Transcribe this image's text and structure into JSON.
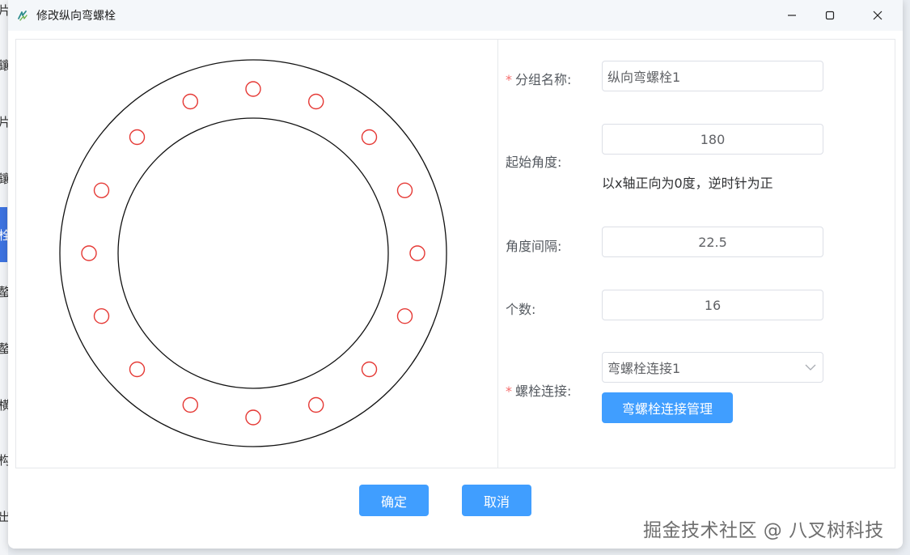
{
  "window": {
    "title": "修改纵向弯螺栓",
    "minimize_icon": "minimize-icon",
    "maximize_icon": "maximize-icon",
    "close_icon": "close-icon"
  },
  "background_app": {
    "side_chars": [
      "片",
      "鑲",
      "片",
      "鑲",
      "栓",
      "螯",
      "螯",
      "横",
      "构",
      "出"
    ]
  },
  "drawing": {
    "bolt_count": 16,
    "bolt_color": "#e53935",
    "ring_color": "#111111"
  },
  "form": {
    "group_name": {
      "label": "分组名称:",
      "required": "*",
      "value": "纵向弯螺栓1"
    },
    "start_angle": {
      "label": "起始角度:",
      "value": "180",
      "hint": "以x轴正向为0度，逆时针为正"
    },
    "angle_interval": {
      "label": "角度间隔:",
      "value": "22.5"
    },
    "count": {
      "label": "个数:",
      "value": "16"
    },
    "bolt_connection": {
      "label": "螺栓连接:",
      "required": "*",
      "value": "弯螺栓连接1",
      "manage_button": "弯螺栓连接管理"
    }
  },
  "footer": {
    "confirm": "确定",
    "cancel": "取消"
  },
  "watermark": "掘金技术社区 @ 八叉树科技",
  "colors": {
    "primary": "#409eff",
    "required": "#f56c6c",
    "background_accent": "#3d73e0"
  }
}
